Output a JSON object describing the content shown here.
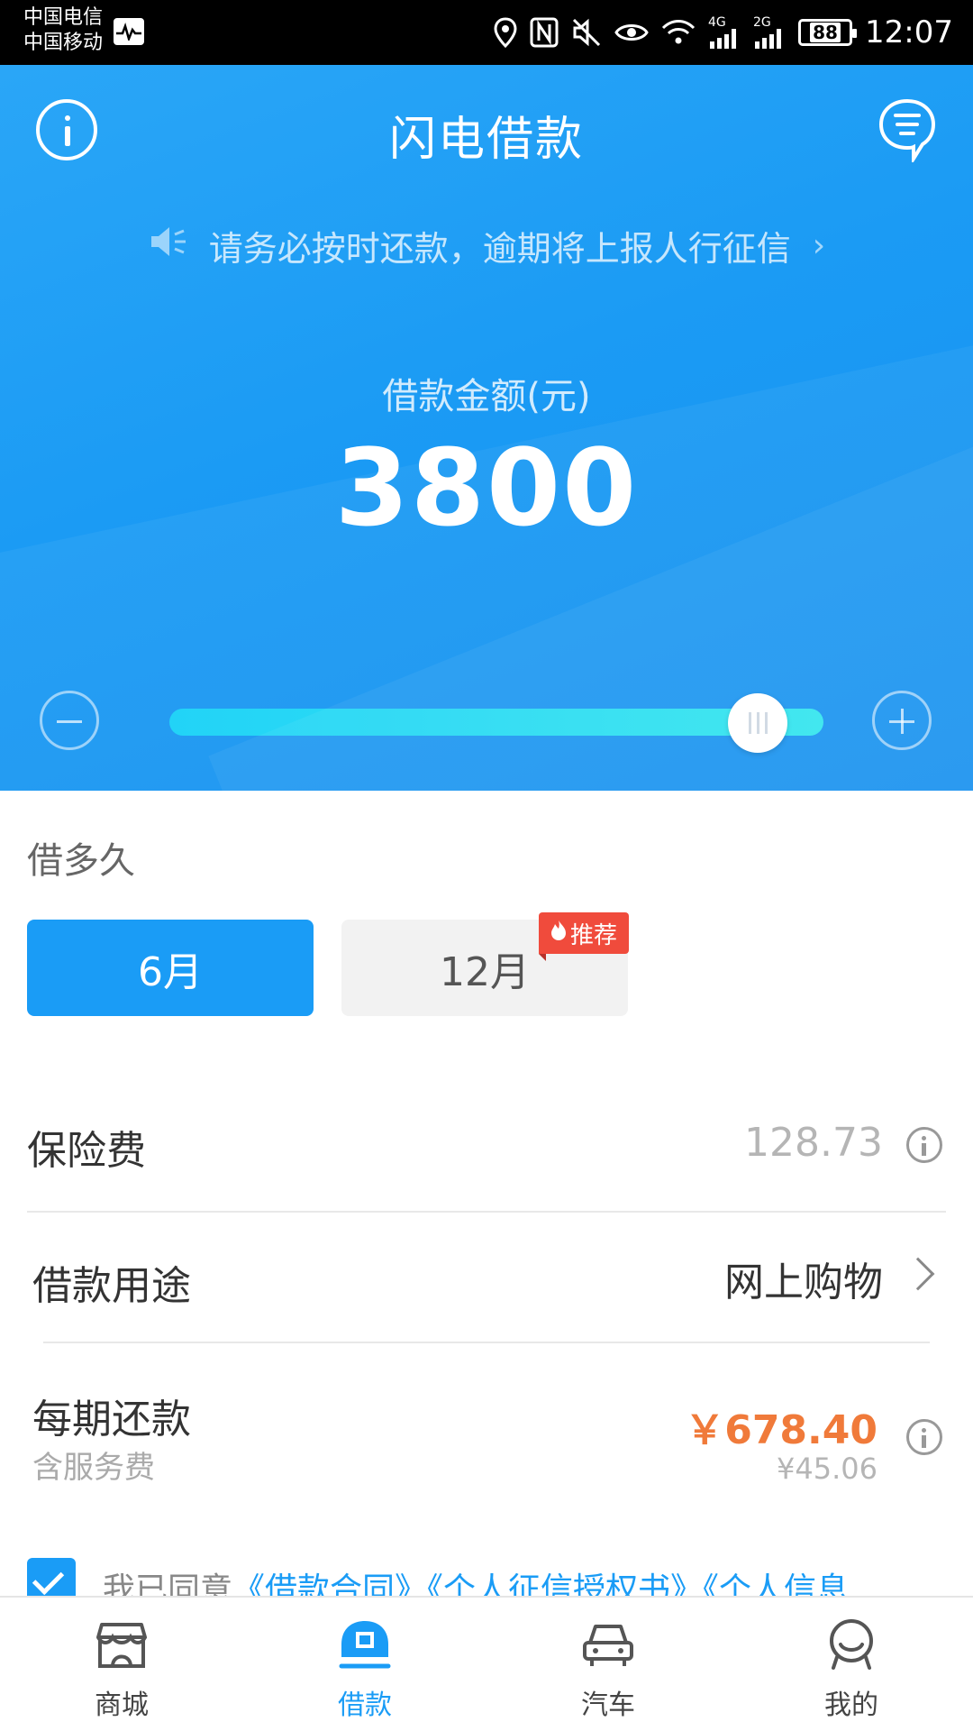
{
  "status_bar": {
    "carrier_1": "中国电信",
    "carrier_2": "中国移动",
    "battery": "88",
    "time": "12:07",
    "net_4g": "4G",
    "net_2g": "2G",
    "icons": [
      "pulse-icon",
      "location-icon",
      "nfc-icon",
      "mute-icon",
      "eye-icon",
      "wifi-icon",
      "signal-icon",
      "battery-icon"
    ]
  },
  "header": {
    "title": "闪电借款",
    "notice": "请务必按时还款，逾期将上报人行征信",
    "icons": [
      "info-icon",
      "message-icon",
      "speaker-icon",
      "chevron-right-icon"
    ]
  },
  "loan": {
    "amount_label": "借款金额(元)",
    "amount": "3800",
    "slider_fraction": 0.9
  },
  "term": {
    "label": "借多久",
    "options": [
      "6月",
      "12月"
    ],
    "selected": "6月",
    "badge": "推荐"
  },
  "details": {
    "insurance_label": "保险费",
    "insurance_value": "128.73",
    "purpose_label": "借款用途",
    "purpose_value": "网上购物",
    "repay_label": "每期还款",
    "repay_sub": "含服务费",
    "repay_value": "￥678.40",
    "repay_fee": "¥45.06"
  },
  "agreement": {
    "prefix": "我已同意",
    "link_1": "《借款合同》",
    "link_2": "《个人征信授权书》",
    "link_3": "《个人信息"
  },
  "nav": {
    "items": [
      "商城",
      "借款",
      "汽车",
      "我的"
    ],
    "active": "借款"
  },
  "colors": {
    "primary": "#1a9cf6",
    "orange": "#f07a3a",
    "badge_red": "#f04b3c"
  }
}
